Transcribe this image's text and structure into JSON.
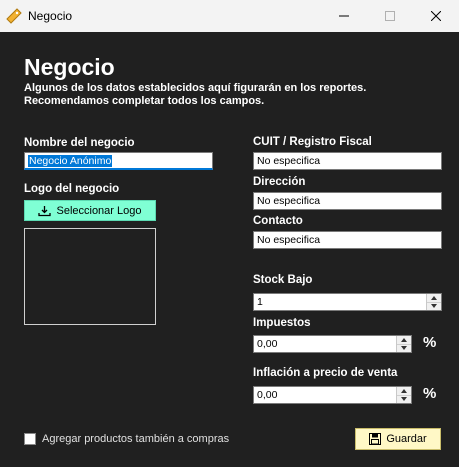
{
  "window": {
    "title": "Negocio"
  },
  "header": {
    "title": "Negocio",
    "description_line1": "Algunos de los datos establecidos aquí figurarán en los reportes.",
    "description_line2": "Recomendamos completar todos los campos."
  },
  "left": {
    "name_label": "Nombre del negocio",
    "name_value": "Negocio Anónimo",
    "logo_label": "Logo del negocio",
    "select_logo_button": "Seleccionar Logo"
  },
  "right": {
    "cuit_label": "CUIT / Registro Fiscal",
    "cuit_value": "No especifica",
    "address_label": "Dirección",
    "address_value": "No especifica",
    "contact_label": "Contacto",
    "contact_value": "No especifica",
    "stock_label": "Stock Bajo",
    "stock_value": "1",
    "tax_label": "Impuestos",
    "tax_value": "0,00",
    "tax_unit": "%",
    "inflation_label": "Inflación a precio de venta",
    "inflation_value": "0,00",
    "inflation_unit": "%"
  },
  "footer": {
    "checkbox_label": "Agregar productos también a compras",
    "save_button": "Guardar"
  }
}
